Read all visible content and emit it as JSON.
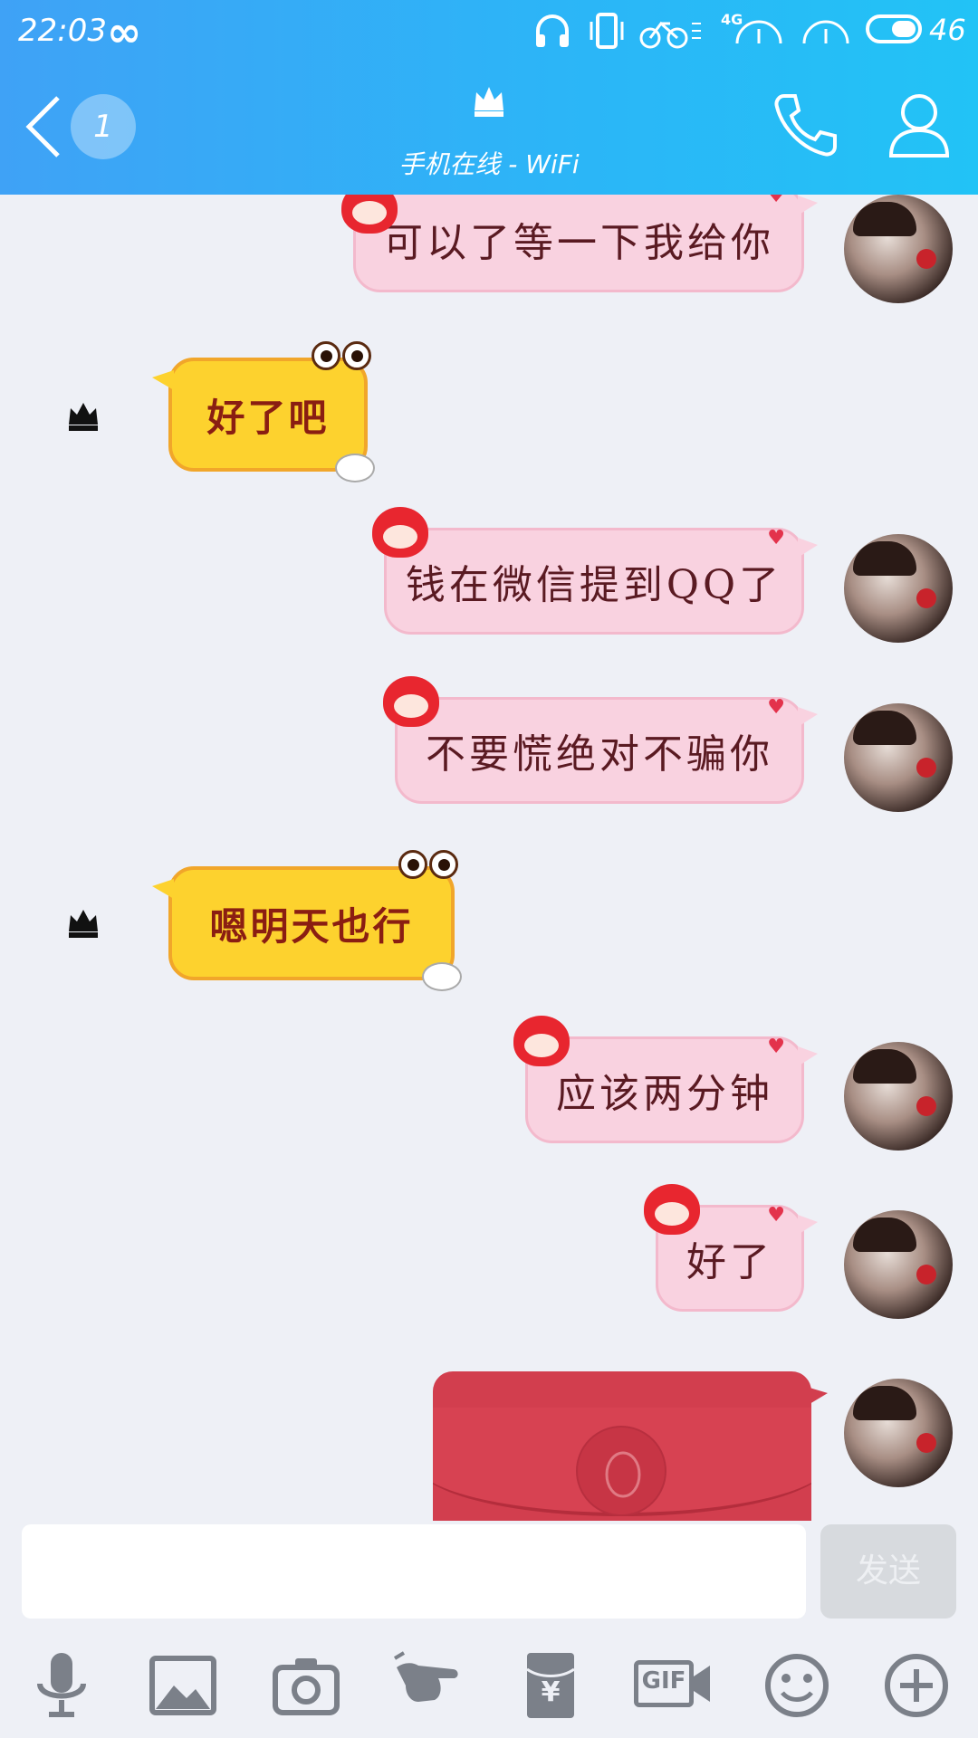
{
  "status_bar": {
    "time": "22:03",
    "network": "4G",
    "battery": "46"
  },
  "header": {
    "unread_count": "1",
    "status": "手机在线 - WiFi",
    "icons": [
      "back-arrow-icon",
      "crown-icon",
      "phone-icon",
      "profile-icon"
    ]
  },
  "messages": [
    {
      "side": "right",
      "text": "可以了等一下我给你"
    },
    {
      "side": "left",
      "text": "好了吧"
    },
    {
      "side": "right",
      "text": "钱在微信提到QQ了"
    },
    {
      "side": "right",
      "text": "不要慌绝对不骗你"
    },
    {
      "side": "left",
      "text": "嗯明天也行"
    },
    {
      "side": "right",
      "text": "应该两分钟"
    },
    {
      "side": "right",
      "text": "好了"
    },
    {
      "side": "right",
      "type": "red-packet"
    }
  ],
  "input": {
    "value": "",
    "send_label": "发送"
  },
  "toolbar": {
    "items": [
      "microphone-icon",
      "image-icon",
      "camera-icon",
      "poke-icon",
      "red-packet-icon",
      "gif-icon",
      "emoji-icon",
      "plus-icon"
    ],
    "gif_label": "GIF",
    "yen_label": "¥"
  },
  "colors": {
    "header_start": "#3fa2f6",
    "header_end": "#22c3f6",
    "pink_bubble": "#f9d2e0",
    "yellow_bubble": "#fdd22e",
    "red_packet": "#d23e4e"
  }
}
